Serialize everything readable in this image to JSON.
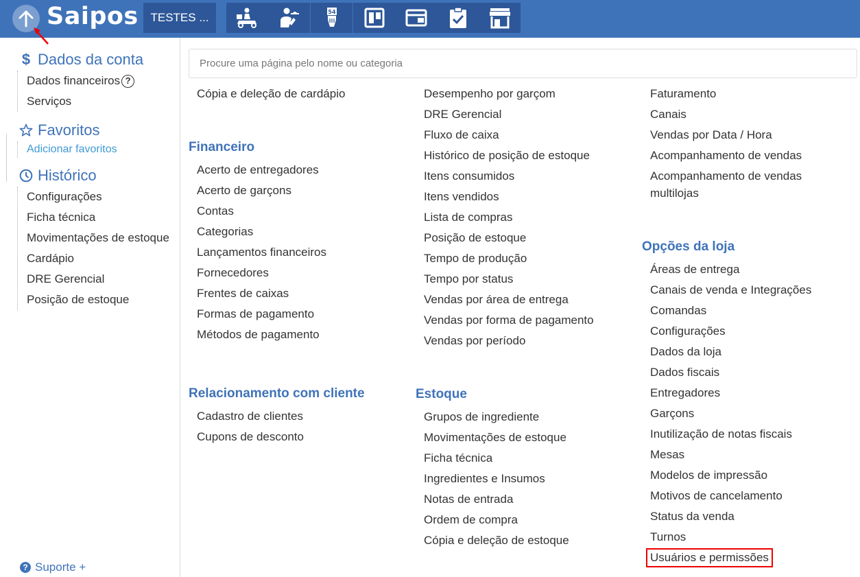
{
  "topbar": {
    "logo": "Saipos",
    "store_button": "TESTES ...",
    "nav_icons": [
      "delivery-icon",
      "waiter-icon",
      "table-number-icon",
      "board-icon",
      "display-icon",
      "checklist-icon",
      "store-icon"
    ]
  },
  "sidebar": {
    "account": {
      "title": "Dados da conta",
      "items": [
        "Dados financeiros",
        "Serviços"
      ]
    },
    "favorites": {
      "title": "Favoritos",
      "add_link": "Adicionar favoritos"
    },
    "history": {
      "title": "Histórico",
      "items": [
        "Configurações",
        "Ficha técnica",
        "Movimentações de estoque",
        "Cardápio",
        "DRE Gerencial",
        "Posição de estoque"
      ]
    },
    "support": "Suporte +"
  },
  "search": {
    "placeholder": "Procure uma página pelo nome ou categoria"
  },
  "columns": {
    "col1": {
      "top_items": [
        "Cópia e deleção de cardápio"
      ],
      "financeiro": {
        "title": "Financeiro",
        "items": [
          "Acerto de entregadores",
          "Acerto de garçons",
          "Contas",
          "Categorias",
          "Lançamentos financeiros",
          "Fornecedores",
          "Frentes de caixas",
          "Formas de pagamento",
          "Métodos de pagamento"
        ]
      },
      "relacionamento": {
        "title": "Relacionamento com cliente",
        "items": [
          "Cadastro de clientes",
          "Cupons de desconto"
        ]
      }
    },
    "col2": {
      "top_items": [
        "Desempenho por garçom",
        "DRE Gerencial",
        "Fluxo de caixa",
        "Histórico de posição de estoque",
        "Itens consumidos",
        "Itens vendidos",
        "Lista de compras",
        "Posição de estoque",
        "Tempo de produção",
        "Tempo por status",
        "Vendas por área de entrega",
        "Vendas por forma de pagamento",
        "Vendas por período"
      ],
      "estoque": {
        "title": "Estoque",
        "items": [
          "Grupos de ingrediente",
          "Movimentações de estoque",
          "Ficha técnica",
          "Ingredientes e Insumos",
          "Notas de entrada",
          "Ordem de compra",
          "Cópia e deleção de estoque"
        ]
      }
    },
    "col3": {
      "top_items": [
        "Faturamento",
        "Canais",
        "Vendas por Data / Hora",
        "Acompanhamento de vendas",
        "Acompanhamento de vendas multilojas"
      ],
      "opcoes": {
        "title": "Opções da loja",
        "items": [
          "Áreas de entrega",
          "Canais de venda e Integrações",
          "Comandas",
          "Configurações",
          "Dados da loja",
          "Dados fiscais",
          "Entregadores",
          "Garçons",
          "Inutilização de notas fiscais",
          "Mesas",
          "Modelos de impressão",
          "Motivos de cancelamento",
          "Status da venda",
          "Turnos",
          "Usuários e permissões"
        ]
      }
    }
  },
  "colors": {
    "primary": "#3f73b9",
    "dark_primary": "#2d5798",
    "link": "#3f9ad6",
    "highlight": "#e00000"
  }
}
